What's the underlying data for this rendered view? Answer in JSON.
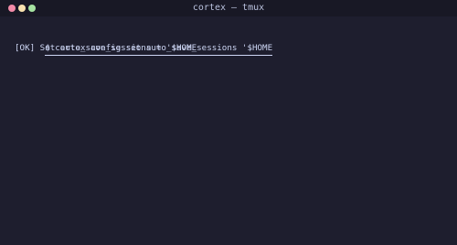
{
  "window": {
    "title": "cortex — tmux",
    "colors": {
      "background": "#1e1e2e",
      "titlebar": "#181825",
      "text": "#cdd6f4",
      "close": "#f38ba8",
      "minimize": "#f9e2af",
      "maximize": "#a6e3a1"
    }
  },
  "terminal": {
    "lines": [
      "$ cortex config set auto_save_sessions '$HOME",
      "[OK] Set auto_save_sessions = '$HOME"
    ]
  }
}
